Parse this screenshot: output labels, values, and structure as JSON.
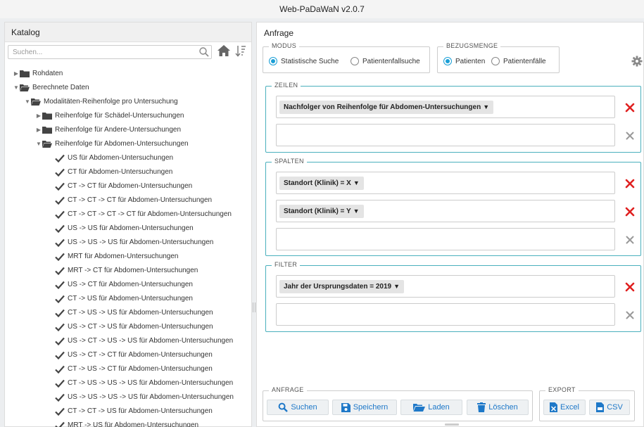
{
  "window": {
    "title": "Web-PaDaWaN v2.0.7"
  },
  "catalog": {
    "title": "Katalog",
    "search_placeholder": "Suchen...",
    "tree": [
      {
        "label": "Rohdaten",
        "kind": "folder",
        "level": 0,
        "expanded": false
      },
      {
        "label": "Berechnete Daten",
        "kind": "folder",
        "level": 0,
        "expanded": true
      },
      {
        "label": "Modalitäten-Reihenfolge pro Untersuchung",
        "kind": "folder",
        "level": 1,
        "expanded": true
      },
      {
        "label": "Reihenfolge für Schädel-Untersuchungen",
        "kind": "folder",
        "level": 2,
        "expanded": false
      },
      {
        "label": "Reihenfolge für Andere-Untersuchungen",
        "kind": "folder",
        "level": 2,
        "expanded": false
      },
      {
        "label": "Reihenfolge für Abdomen-Untersuchungen",
        "kind": "folder",
        "level": 2,
        "expanded": true
      },
      {
        "label": "US für Abdomen-Untersuchungen",
        "kind": "item",
        "level": 3
      },
      {
        "label": "CT für Abdomen-Untersuchungen",
        "kind": "item",
        "level": 3
      },
      {
        "label": "CT -> CT für Abdomen-Untersuchungen",
        "kind": "item",
        "level": 3
      },
      {
        "label": "CT -> CT -> CT für Abdomen-Untersuchungen",
        "kind": "item",
        "level": 3
      },
      {
        "label": "CT -> CT -> CT -> CT für Abdomen-Untersuchungen",
        "kind": "item",
        "level": 3
      },
      {
        "label": "US -> US für Abdomen-Untersuchungen",
        "kind": "item",
        "level": 3
      },
      {
        "label": "US -> US -> US für Abdomen-Untersuchungen",
        "kind": "item",
        "level": 3
      },
      {
        "label": "MRT für Abdomen-Untersuchungen",
        "kind": "item",
        "level": 3
      },
      {
        "label": "MRT -> CT für Abdomen-Untersuchungen",
        "kind": "item",
        "level": 3
      },
      {
        "label": "US -> CT für Abdomen-Untersuchungen",
        "kind": "item",
        "level": 3
      },
      {
        "label": "CT -> US für Abdomen-Untersuchungen",
        "kind": "item",
        "level": 3
      },
      {
        "label": "CT -> US -> US für Abdomen-Untersuchungen",
        "kind": "item",
        "level": 3
      },
      {
        "label": "US -> CT -> US für Abdomen-Untersuchungen",
        "kind": "item",
        "level": 3
      },
      {
        "label": "US -> CT -> US -> US für Abdomen-Untersuchungen",
        "kind": "item",
        "level": 3
      },
      {
        "label": "US -> CT -> CT für Abdomen-Untersuchungen",
        "kind": "item",
        "level": 3
      },
      {
        "label": "CT -> US -> CT für Abdomen-Untersuchungen",
        "kind": "item",
        "level": 3
      },
      {
        "label": "CT -> US -> US -> US für Abdomen-Untersuchungen",
        "kind": "item",
        "level": 3
      },
      {
        "label": "US -> US -> US -> US für Abdomen-Untersuchungen",
        "kind": "item",
        "level": 3
      },
      {
        "label": "CT -> CT -> US für Abdomen-Untersuchungen",
        "kind": "item",
        "level": 3
      },
      {
        "label": "MRT -> US für Abdomen-Untersuchungen",
        "kind": "item",
        "level": 3
      }
    ]
  },
  "query": {
    "title": "Anfrage",
    "modus": {
      "legend": "MODUS",
      "options": [
        "Statistische Suche",
        "Patientenfallsuche"
      ],
      "selected": "Statistische Suche"
    },
    "bezugsmenge": {
      "legend": "BEZUGSMENGE",
      "options": [
        "Patienten",
        "Patientenfälle"
      ],
      "selected": "Patienten"
    },
    "zeilen": {
      "legend": "ZEILEN",
      "chips": [
        "Nachfolger von Reihenfolge für Abdomen-Untersuchungen"
      ]
    },
    "spalten": {
      "legend": "SPALTEN",
      "chips": [
        "Standort (Klinik) = X",
        "Standort (Klinik) = Y"
      ]
    },
    "filter": {
      "legend": "FILTER",
      "chips": [
        "Jahr der Ursprungsdaten = 2019"
      ]
    },
    "actions": {
      "legend": "ANFRAGE",
      "search": "Suchen",
      "save": "Speichern",
      "load": "Laden",
      "delete": "Löschen"
    },
    "export": {
      "legend": "EXPORT",
      "excel": "Excel",
      "csv": "CSV"
    }
  },
  "colors": {
    "accent": "#1a9fd6",
    "section_border": "#4ab0bd",
    "remove_red": "#e02020",
    "remove_grey": "#999999",
    "button_text": "#1e78c8"
  }
}
